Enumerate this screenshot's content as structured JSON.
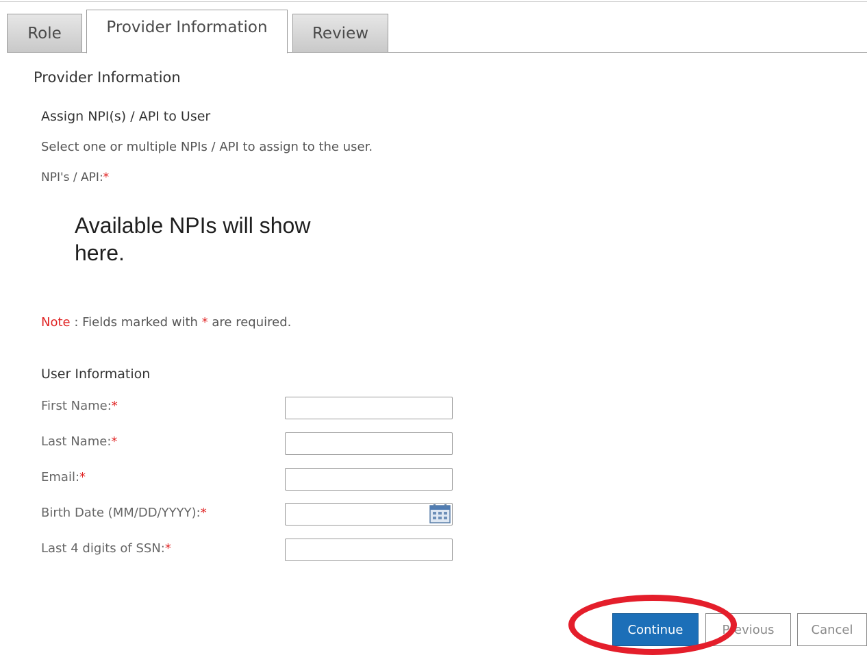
{
  "tabs": [
    {
      "label": "Role",
      "active": false
    },
    {
      "label": "Provider Information",
      "active": true
    },
    {
      "label": "Review",
      "active": false
    }
  ],
  "section_title": "Provider Information",
  "assign": {
    "title": "Assign NPI(s) / API to User",
    "instruction": "Select one or multiple NPIs / API to assign to the user.",
    "npi_label": "NPI's / API:",
    "placeholder": "Available NPIs will show here."
  },
  "required_marker": "*",
  "note": {
    "word": "Note",
    "text_before": " : Fields marked with ",
    "text_after": " are required."
  },
  "user_info": {
    "title": "User Information",
    "fields": [
      {
        "label": "First Name:",
        "value": ""
      },
      {
        "label": "Last Name:",
        "value": ""
      },
      {
        "label": "Email:",
        "value": ""
      },
      {
        "label": "Birth Date (MM/DD/YYYY):",
        "value": ""
      },
      {
        "label": "Last 4 digits of SSN:",
        "value": ""
      }
    ]
  },
  "buttons": {
    "continue": "Continue",
    "previous": "Previous",
    "cancel": "Cancel"
  },
  "colors": {
    "accent": "#1c6fb8",
    "required": "#e02424",
    "highlight": "#e41e2b"
  },
  "icons": {
    "calendar": "calendar-icon"
  }
}
